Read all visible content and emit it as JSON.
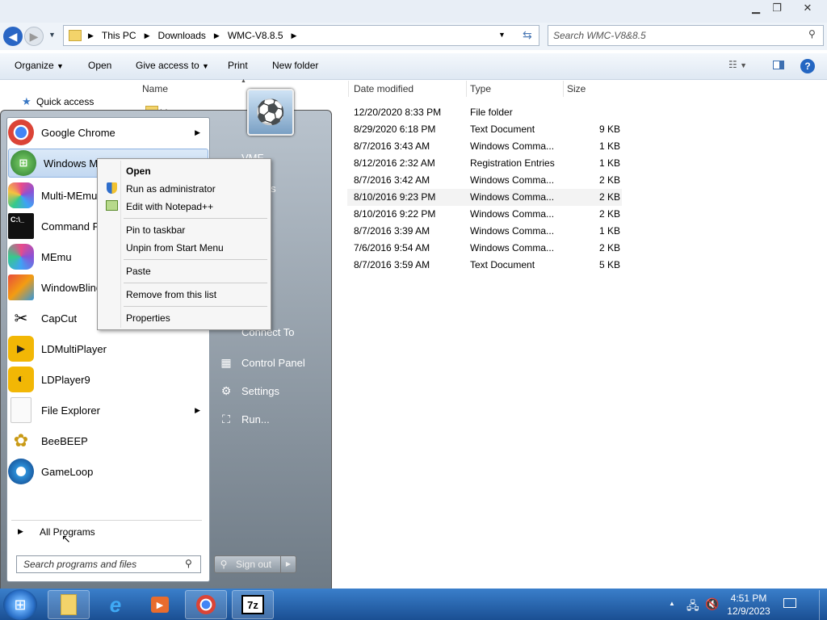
{
  "explorer": {
    "breadcrumb": [
      "This PC",
      "Downloads",
      "WMC-V8.8.5"
    ],
    "search_placeholder": "Search WMC-V8&8.5",
    "toolbar": {
      "organize": "Organize",
      "open": "Open",
      "give_access": "Give access to",
      "print": "Print",
      "new_folder": "New folder"
    },
    "nav": {
      "quick_access": "Quick access"
    },
    "columns": {
      "name": "Name",
      "date": "Date modified",
      "type": "Type",
      "size": "Size"
    },
    "rows": [
      {
        "name": "bin",
        "date": "12/20/2020 8:33 PM",
        "type": "File folder",
        "size": ""
      },
      {
        "name": "",
        "date": "8/29/2020 6:18 PM",
        "type": "Text Document",
        "size": "9 KB"
      },
      {
        "name": "",
        "date": "8/7/2016 3:43 AM",
        "type": "Windows Comma...",
        "size": "1 KB"
      },
      {
        "name": "",
        "date": "8/12/2016 2:32 AM",
        "type": "Registration Entries",
        "size": "1 KB"
      },
      {
        "name": "",
        "date": "8/7/2016 3:42 AM",
        "type": "Windows Comma...",
        "size": "2 KB"
      },
      {
        "name": "",
        "date": "8/10/2016 9:23 PM",
        "type": "Windows Comma...",
        "size": "2 KB"
      },
      {
        "name": "",
        "date": "8/10/2016 9:22 PM",
        "type": "Windows Comma...",
        "size": "2 KB"
      },
      {
        "name": "",
        "date": "8/7/2016 3:39 AM",
        "type": "Windows Comma...",
        "size": "1 KB"
      },
      {
        "name": "",
        "date": "7/6/2016 9:54 AM",
        "type": "Windows Comma...",
        "size": "2 KB"
      },
      {
        "name": "",
        "date": "8/7/2016 3:59 AM",
        "type": "Text Document",
        "size": "5 KB"
      }
    ]
  },
  "start_menu": {
    "programs": [
      {
        "label": "Google Chrome",
        "icon": "chrome-icon",
        "color": "#db4437",
        "glyph": "●"
      },
      {
        "label": "Windows Me",
        "icon": "windows-media-center-icon",
        "color": "#2f8f3a",
        "glyph": "⊞"
      },
      {
        "label": "Multi-MEmu",
        "icon": "multi-memu-icon",
        "color": "#8a52d6",
        "glyph": "◆"
      },
      {
        "label": "Command Pr",
        "icon": "command-prompt-icon",
        "color": "#111111",
        "glyph": "C:"
      },
      {
        "label": "MEmu",
        "icon": "memu-icon",
        "color": "#7b4fe0",
        "glyph": "◆"
      },
      {
        "label": "WindowBlind",
        "icon": "windowblinds-icon",
        "color": "#d9532c",
        "glyph": "▦"
      },
      {
        "label": "CapCut",
        "icon": "capcut-icon",
        "color": "#ffffff",
        "glyph": "✂"
      },
      {
        "label": "LDMultiPlayer",
        "icon": "ldmultiplayer-icon",
        "color": "#f2b705",
        "glyph": "▶"
      },
      {
        "label": "LDPlayer9",
        "icon": "ldplayer9-icon",
        "color": "#f2b705",
        "glyph": "◐"
      },
      {
        "label": "File Explorer",
        "icon": "file-explorer-icon",
        "color": "#f5f5f5",
        "glyph": "▭"
      },
      {
        "label": "BeeBEEP",
        "icon": "beebeep-icon",
        "color": "#e8c53a",
        "glyph": "✦"
      },
      {
        "label": "GameLoop",
        "icon": "gameloop-icon",
        "color": "#2d8fd8",
        "glyph": "◎"
      }
    ],
    "all_programs": "All Programs",
    "search_placeholder": "Search programs and files",
    "right_items": [
      {
        "label": "VMF",
        "icon": "user-folder-icon"
      },
      {
        "label": "uments",
        "icon": "documents-icon"
      },
      {
        "label": "s",
        "icon": "pictures-icon"
      },
      {
        "label": "oads",
        "icon": "downloads-icon"
      },
      {
        "label": "Connect To",
        "icon": "connect-to-icon"
      },
      {
        "label": "Control Panel",
        "icon": "control-panel-icon"
      },
      {
        "label": "Settings",
        "icon": "settings-gear-icon"
      },
      {
        "label": "Run...",
        "icon": "run-icon"
      }
    ],
    "sign_out": "Sign out"
  },
  "context_menu": {
    "items": [
      {
        "label": "Open",
        "bold": true
      },
      {
        "label": "Run as administrator",
        "icon": "uac-shield-icon"
      },
      {
        "label": "Edit with Notepad++",
        "icon": "notepad-plus-plus-icon"
      },
      {
        "label": "Pin to taskbar"
      },
      {
        "label": "Unpin from Start Menu"
      },
      {
        "label": "Paste"
      },
      {
        "label": "Remove from this list"
      },
      {
        "label": "Properties"
      }
    ]
  },
  "taskbar": {
    "time": "4:51 PM",
    "date": "12/9/2023"
  }
}
